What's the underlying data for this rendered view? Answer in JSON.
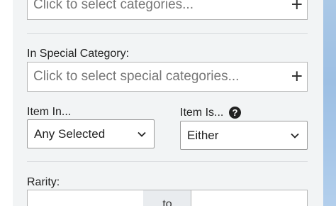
{
  "categories": {
    "placeholder": "Click to select categories...",
    "add_glyph": "+"
  },
  "special_category": {
    "label": "In Special Category:",
    "placeholder": "Click to select special categories...",
    "add_glyph": "+"
  },
  "item_in": {
    "label": "Item In...",
    "selected": "Any Selected"
  },
  "item_is": {
    "label": "Item Is...",
    "help_glyph": "?",
    "selected": "Either"
  },
  "rarity": {
    "label": "Rarity:",
    "from_value": "",
    "to_label": "to",
    "to_value": ""
  },
  "colors": {
    "panel_bg": "#f2f4f5",
    "border": "#b5b5b5",
    "placeholder_text": "#777777",
    "right_edge_blue": "#a6c6e8"
  }
}
